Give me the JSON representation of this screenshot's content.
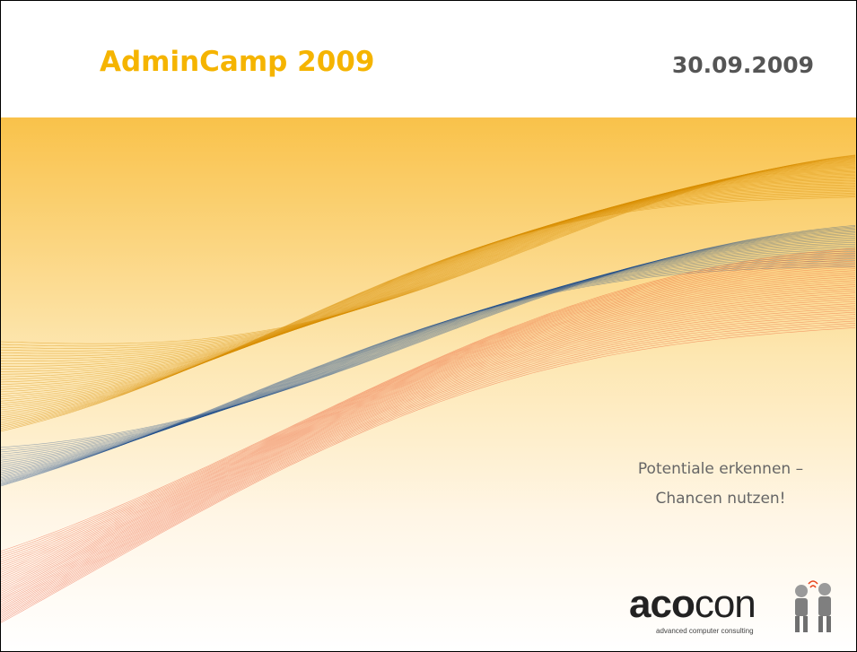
{
  "slide": {
    "title": "AdminCamp 2009",
    "date": "30.09.2009",
    "tagline_line1": "Potentiale erkennen –",
    "tagline_line2": "Chancen nutzen!",
    "logo_bold": "aco",
    "logo_light": "con",
    "logo_subtitle": "advanced computer consulting"
  },
  "colors": {
    "title": "#f5b400",
    "date": "#555555",
    "band_top": "#f9c24a",
    "ribbon_gold": "#d98e00",
    "ribbon_blue": "#1f4e8c",
    "ribbon_red": "#e8421a"
  }
}
